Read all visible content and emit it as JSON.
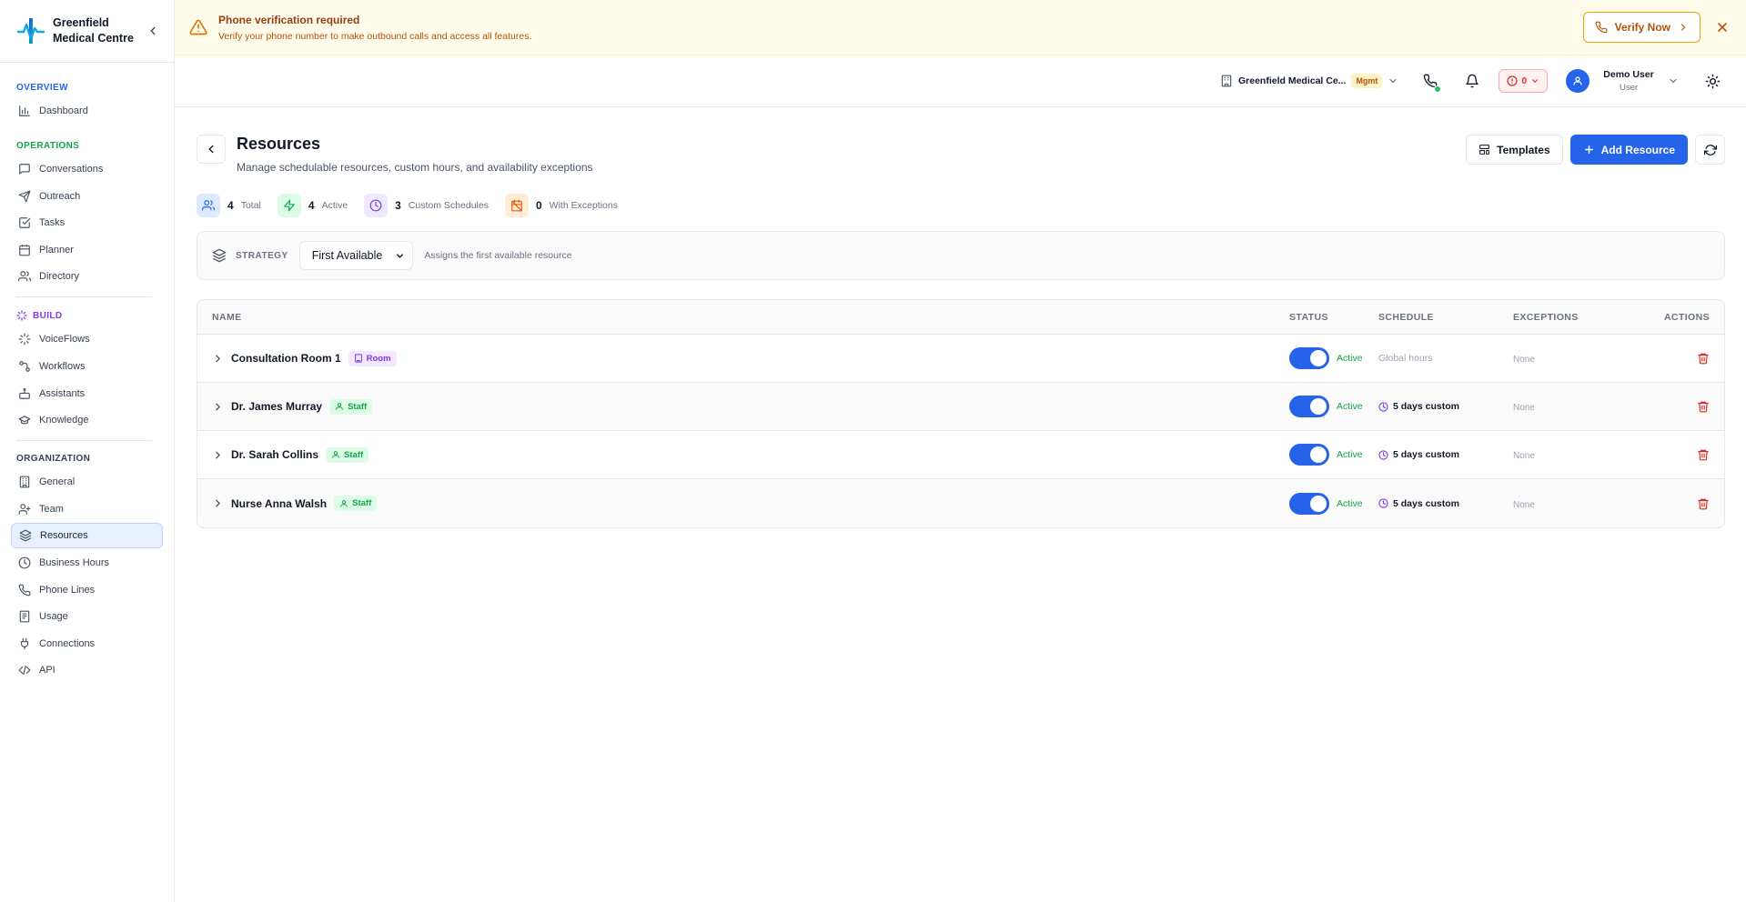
{
  "brand": {
    "name_line1": "Greenfield",
    "name_line2": "Medical Centre"
  },
  "sidebar": {
    "groups": [
      {
        "title": "OVERVIEW",
        "items": [
          {
            "label": "Dashboard",
            "icon": "bar-chart-icon"
          }
        ]
      },
      {
        "title": "OPERATIONS",
        "items": [
          {
            "label": "Conversations",
            "icon": "message-icon"
          },
          {
            "label": "Outreach",
            "icon": "send-icon"
          },
          {
            "label": "Tasks",
            "icon": "checkbox-icon"
          },
          {
            "label": "Planner",
            "icon": "calendar-icon"
          },
          {
            "label": "Directory",
            "icon": "users-icon"
          }
        ]
      },
      {
        "title": "BUILD",
        "items": [
          {
            "label": "VoiceFlows",
            "icon": "sparkle-icon"
          },
          {
            "label": "Workflows",
            "icon": "workflow-icon"
          },
          {
            "label": "Assistants",
            "icon": "bot-icon"
          },
          {
            "label": "Knowledge",
            "icon": "graduation-cap-icon"
          }
        ]
      },
      {
        "title": "ORGANIZATION",
        "items": [
          {
            "label": "General",
            "icon": "building-icon"
          },
          {
            "label": "Team",
            "icon": "user-plus-icon"
          },
          {
            "label": "Resources",
            "icon": "layers-icon",
            "active": true
          },
          {
            "label": "Business Hours",
            "icon": "clock-icon"
          },
          {
            "label": "Phone Lines",
            "icon": "phone-icon"
          },
          {
            "label": "Usage",
            "icon": "receipt-icon"
          },
          {
            "label": "Connections",
            "icon": "plug-icon"
          },
          {
            "label": "API",
            "icon": "code-icon"
          }
        ]
      }
    ]
  },
  "banner": {
    "title": "Phone verification required",
    "message": "Verify your phone number to make outbound calls and access all features.",
    "verify_label": "Verify Now"
  },
  "topbar": {
    "org_name": "Greenfield Medical Ce...",
    "org_badge": "Mgmt",
    "alert_count": "0",
    "user_name": "Demo User",
    "user_role": "User"
  },
  "page": {
    "title": "Resources",
    "subtitle": "Manage schedulable resources, custom hours, and availability exceptions",
    "templates_label": "Templates",
    "add_label": "Add Resource"
  },
  "stats": [
    {
      "value": "4",
      "label": "Total"
    },
    {
      "value": "4",
      "label": "Active"
    },
    {
      "value": "3",
      "label": "Custom Schedules"
    },
    {
      "value": "0",
      "label": "With Exceptions"
    }
  ],
  "strategy": {
    "label": "STRATEGY",
    "selected": "First Available",
    "description": "Assigns the first available resource"
  },
  "table": {
    "headers": {
      "name": "NAME",
      "status": "STATUS",
      "schedule": "SCHEDULE",
      "exceptions": "EXCEPTIONS",
      "actions": "ACTIONS"
    },
    "rows": [
      {
        "name": "Consultation Room 1",
        "type": "Room",
        "status": "Active",
        "schedule": "Global hours",
        "exceptions": "None"
      },
      {
        "name": "Dr. James Murray",
        "type": "Staff",
        "status": "Active",
        "schedule": "5 days custom",
        "exceptions": "None"
      },
      {
        "name": "Dr. Sarah Collins",
        "type": "Staff",
        "status": "Active",
        "schedule": "5 days custom",
        "exceptions": "None"
      },
      {
        "name": "Nurse Anna Walsh",
        "type": "Staff",
        "status": "Active",
        "schedule": "5 days custom",
        "exceptions": "None"
      }
    ]
  },
  "colors": {
    "accent": "#2563eb",
    "warning": "#d97706",
    "success": "#16a34a",
    "danger": "#dc2626"
  }
}
